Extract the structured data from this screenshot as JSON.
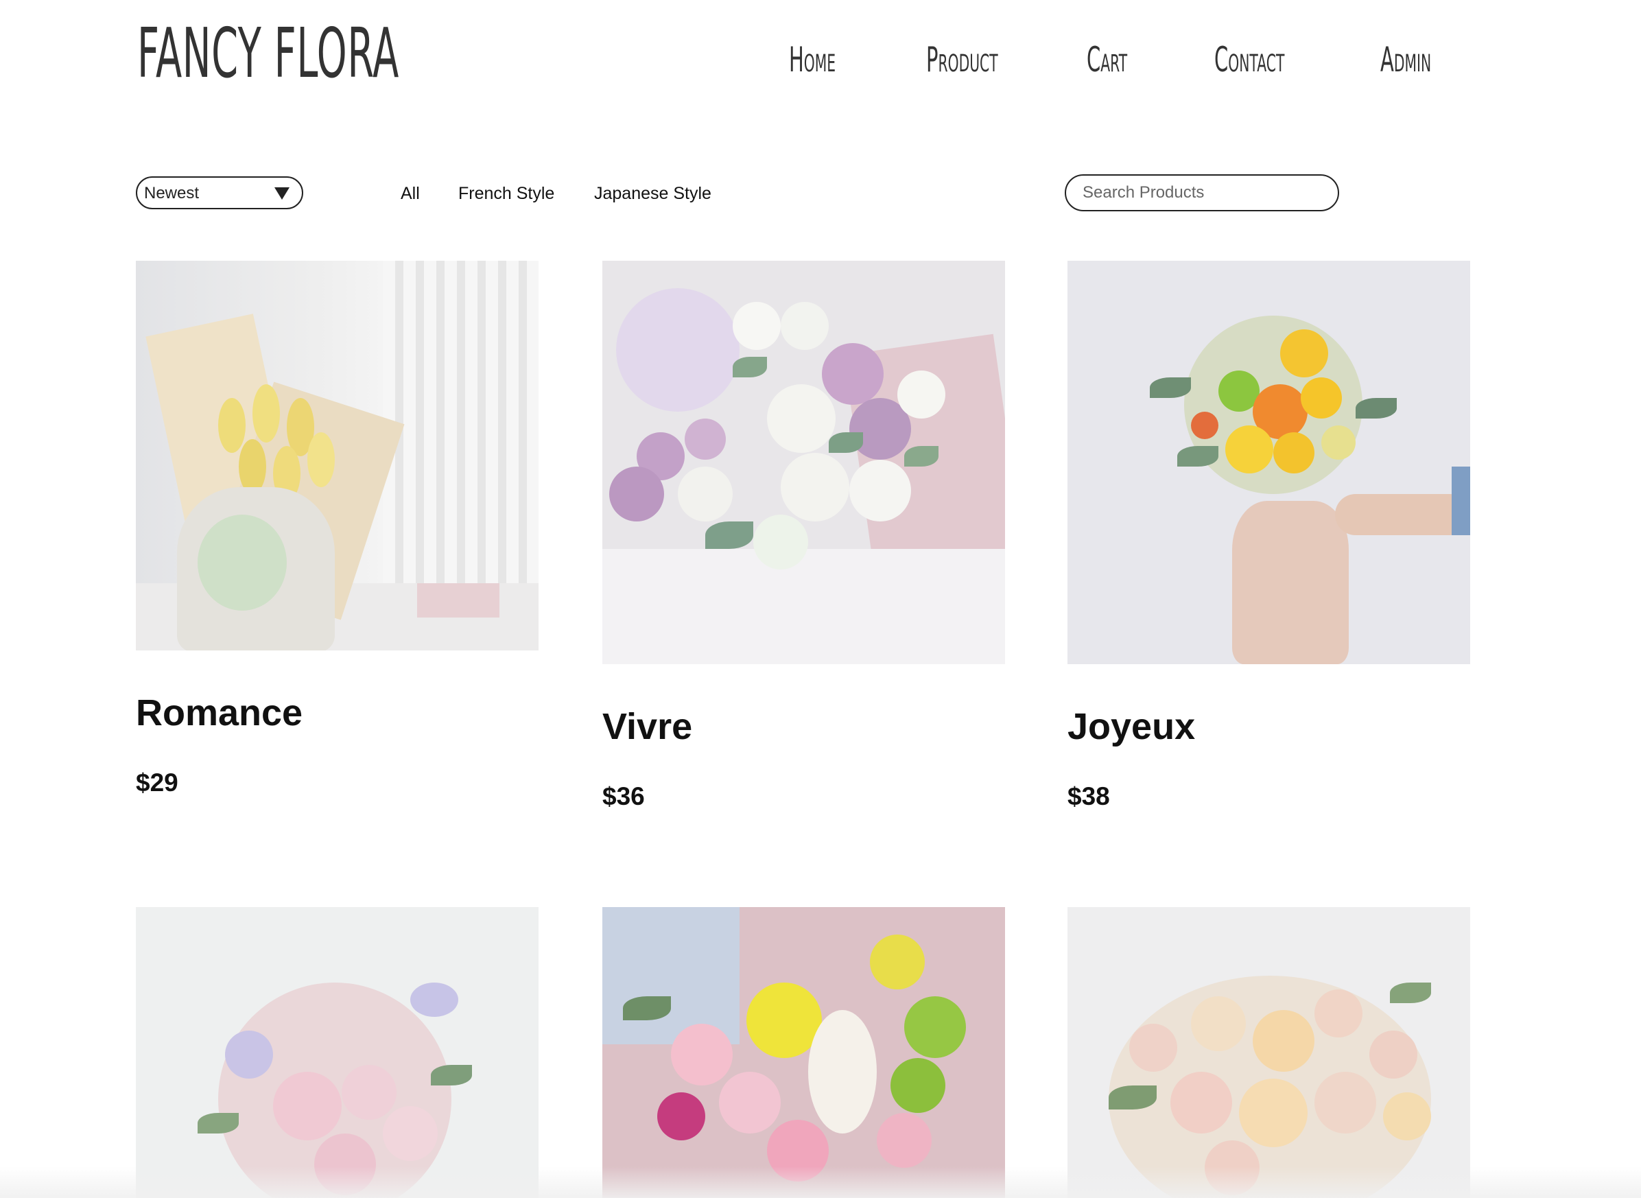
{
  "brand": {
    "logo": "FANCY FLORA"
  },
  "nav": {
    "items": [
      "Home",
      "Product",
      "Cart",
      "Contact",
      "Admin"
    ]
  },
  "toolbar": {
    "sort_value": "Newest",
    "filters": [
      "All",
      "French Style",
      "Japanese Style"
    ],
    "search_placeholder": "Search Products"
  },
  "products": [
    {
      "name": "Romance",
      "price": "$29"
    },
    {
      "name": "Vivre",
      "price": "$36"
    },
    {
      "name": "Joyeux",
      "price": "$38"
    },
    {
      "name": "",
      "price": ""
    },
    {
      "name": "",
      "price": ""
    },
    {
      "name": "",
      "price": ""
    }
  ]
}
